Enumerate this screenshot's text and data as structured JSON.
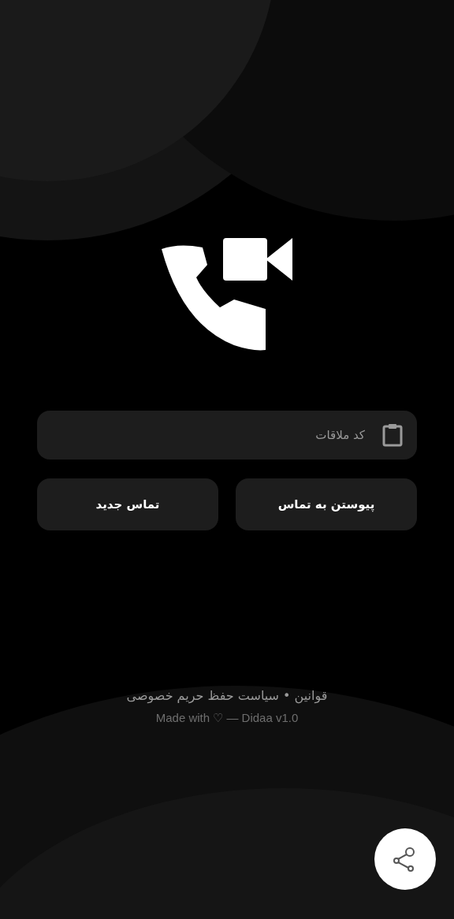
{
  "code_field": {
    "placeholder": "کد ملاقات"
  },
  "buttons": [
    {
      "label": "پیوستن به تماس"
    },
    {
      "label": "تماس جدید"
    }
  ],
  "footer": {
    "links": "قوانین • سیاست حفظ حریم خصوصی",
    "credit": "Made with ♡ — Didaa v1.0"
  }
}
